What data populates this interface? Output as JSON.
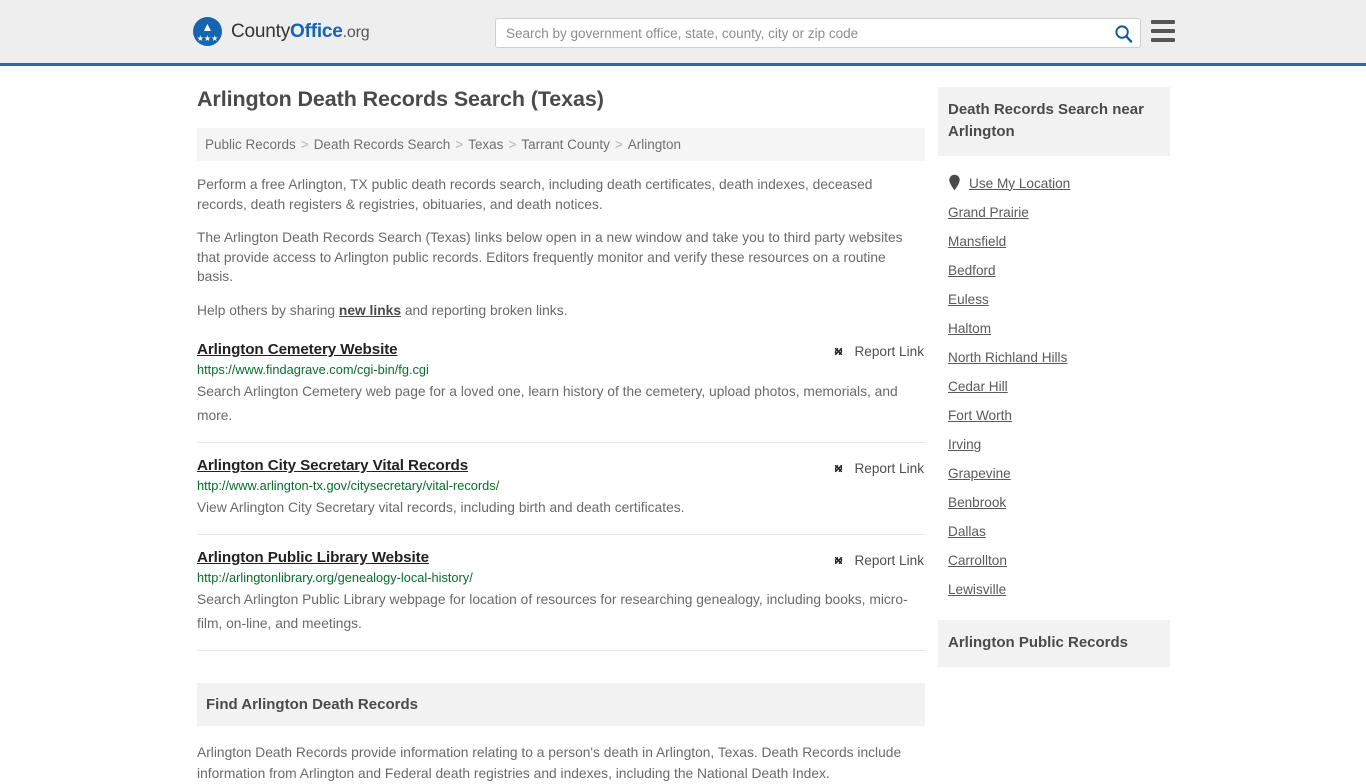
{
  "header": {
    "brand": {
      "county": "County",
      "office": "Office",
      "org": ".org",
      "logo_icon": "eagle-shield-logo"
    },
    "search": {
      "placeholder": "Search by government office, state, county, city or zip code",
      "value": "",
      "search_icon": "search-icon"
    },
    "menu_icon": "hamburger-menu-icon",
    "accent_color": "#2e6da4"
  },
  "main": {
    "title": "Arlington Death Records Search (Texas)",
    "breadcrumb": [
      "Public Records",
      "Death Records Search",
      "Texas",
      "Tarrant County",
      "Arlington"
    ],
    "breadcrumb_separator": ">",
    "intro": [
      "Perform a free Arlington, TX public death records search, including death certificates, death indexes, deceased records, death registers & registries, obituaries, and death notices.",
      "The Arlington Death Records Search (Texas) links below open in a new window and take you to third party websites that provide access to Arlington public records. Editors frequently monitor and verify these resources on a routine basis."
    ],
    "help_prefix": "Help others by sharing ",
    "help_link": "new links",
    "help_suffix": " and reporting broken links.",
    "report_link_label": "Report Link",
    "report_link_icon": "unlink-icon",
    "entries": [
      {
        "title": "Arlington Cemetery Website",
        "url": "https://www.findagrave.com/cgi-bin/fg.cgi",
        "description": "Search Arlington Cemetery web page for a loved one, learn history of the cemetery, upload photos, memorials, and more."
      },
      {
        "title": "Arlington City Secretary Vital Records",
        "url": "http://www.arlington-tx.gov/citysecretary/vital-records/",
        "description": "View Arlington City Secretary vital records, including birth and death certificates."
      },
      {
        "title": "Arlington Public Library Website",
        "url": "http://arlingtonlibrary.org/genealogy-local-history/",
        "description": "Search Arlington Public Library webpage for location of resources for researching genealogy, including books, micro-film, on-line, and meetings."
      }
    ],
    "find_section": {
      "heading": "Find Arlington Death Records",
      "body": "Arlington Death Records provide information relating to a person's death in Arlington, Texas. Death Records include information from Arlington and Federal death registries and indexes, including the National Death Index."
    },
    "url_color": "#0c6b2d"
  },
  "sidebar": {
    "nearby_heading": "Death Records Search near Arlington",
    "use_my_location": {
      "label": "Use My Location",
      "icon": "map-pin-icon"
    },
    "cities": [
      "Grand Prairie",
      "Mansfield",
      "Bedford",
      "Euless",
      "Haltom",
      "North Richland Hills",
      "Cedar Hill",
      "Fort Worth",
      "Irving",
      "Grapevine",
      "Benbrook",
      "Dallas",
      "Carrollton",
      "Lewisville"
    ],
    "public_records_heading": "Arlington Public Records"
  }
}
